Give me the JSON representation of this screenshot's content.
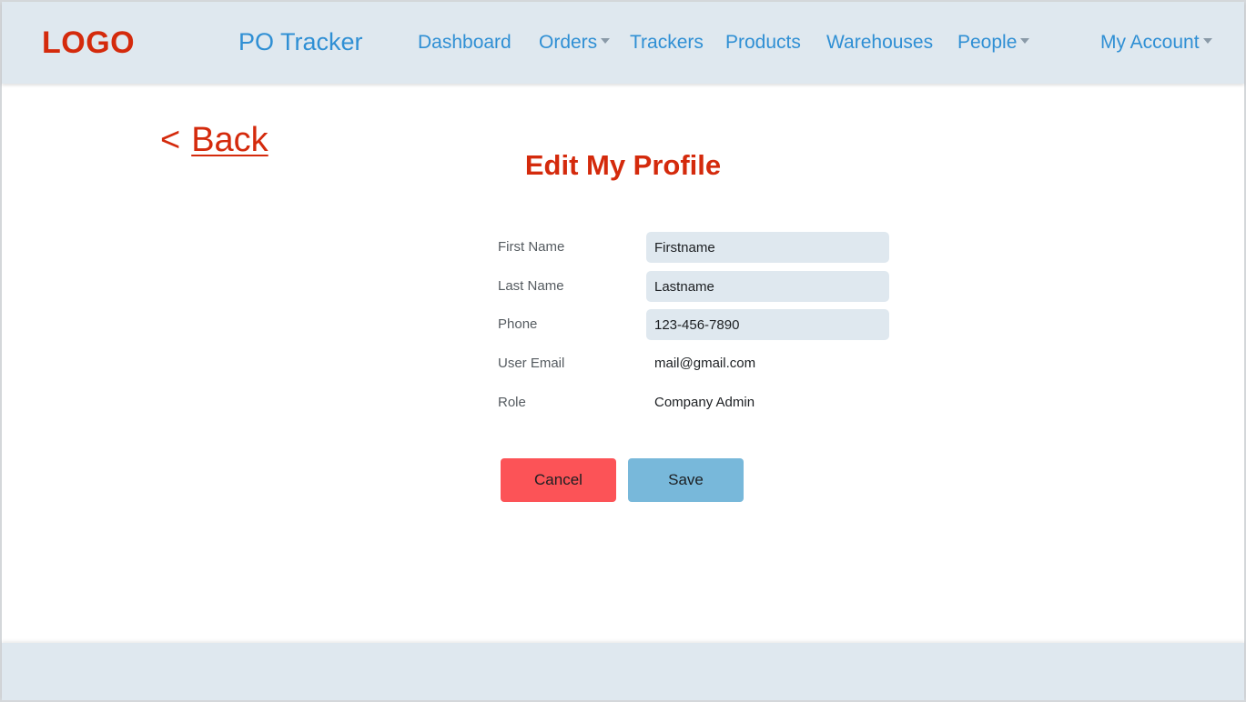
{
  "header": {
    "logo": "LOGO",
    "app_title": "PO Tracker",
    "nav": [
      {
        "label": "Dashboard"
      },
      {
        "label": "Orders"
      },
      {
        "label": "Trackers"
      },
      {
        "label": "Products"
      },
      {
        "label": "Warehouses"
      },
      {
        "label": "People"
      }
    ],
    "account": "My Account"
  },
  "back": {
    "arrow": "<",
    "label": "Back"
  },
  "page_title": "Edit My Profile",
  "form": {
    "first_name": {
      "label": "First Name",
      "value": "Firstname"
    },
    "last_name": {
      "label": "Last Name",
      "value": "Lastname"
    },
    "phone": {
      "label": "Phone",
      "value": "123-456-7890"
    },
    "email": {
      "label": "User Email",
      "value": "mail@gmail.com"
    },
    "role": {
      "label": "Role",
      "value": "Company Admin"
    }
  },
  "buttons": {
    "cancel": "Cancel",
    "save": "Save"
  },
  "colors": {
    "accent_red": "#d42a0c",
    "link_blue": "#2f8fd4",
    "header_bg": "#dfe8ef",
    "cancel_bg": "#fc5357",
    "save_bg": "#78b8da"
  }
}
